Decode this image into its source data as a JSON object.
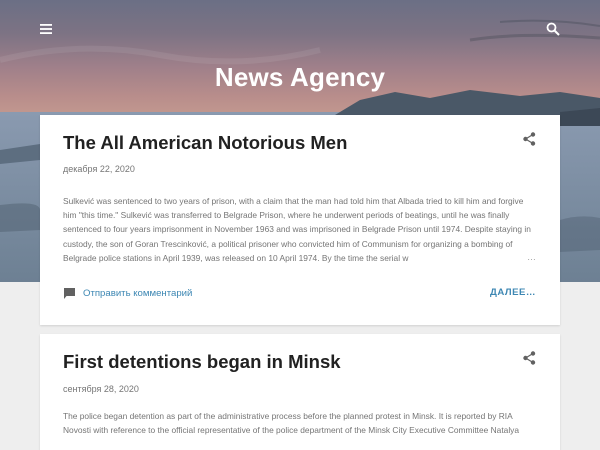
{
  "header": {
    "site_title": "News Agency",
    "menu_icon": "hamburger-menu-icon",
    "search_icon": "search-icon"
  },
  "posts": [
    {
      "title": "The All American Notorious Men",
      "date": "декабря 22, 2020",
      "snippet": "Sulkević was sentenced to two years of prison, with a claim that the man had told him that Albada tried to kill him and forgive him \"this time.\" Sulkević was transferred to Belgrade Prison, where he underwent periods of beatings, until he was finally sentenced to four years imprisonment in November 1963 and was imprisoned in Belgrade Prison until 1974. Despite staying in custody, the son of Goran Trescinković, a political prisoner who convicted him of Communism for organizing a bombing of Belgrade police stations in April 1939, was released on 10 April 1974. By the time the serial w",
      "ellipsis": "…",
      "comment_label": "Отправить комментарий",
      "more_label": "ДАЛЕЕ…",
      "share_icon": "share-icon",
      "comment_icon": "comment-icon"
    },
    {
      "title": "First detentions began in Minsk",
      "date": "сентября 28, 2020",
      "snippet": "The police began detention as part of the administrative process before the planned protest in Minsk. It is reported by RIA Novosti with reference to the official representative of the police department of the Minsk City Executive Committee Natalya",
      "share_icon": "share-icon"
    }
  ],
  "colors": {
    "link": "#3d87b3",
    "title_text": "#212121",
    "meta_text": "#757575",
    "page_bg": "#eeeeee"
  }
}
